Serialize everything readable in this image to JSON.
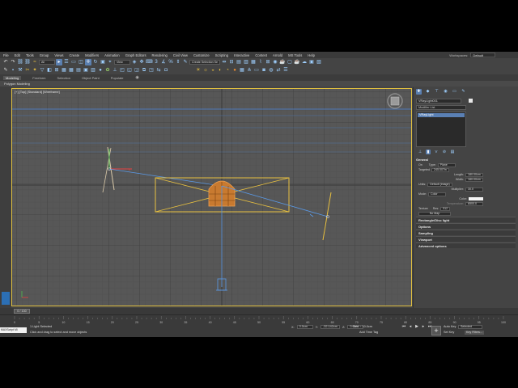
{
  "menu": [
    "File",
    "Edit",
    "Tools",
    "Group",
    "Views",
    "Create",
    "Modifiers",
    "Animation",
    "Graph Editors",
    "Rendering",
    "Civil View",
    "Customize",
    "Scripting",
    "Interactive",
    "Content",
    "Arnold",
    "MS Tools",
    "Help"
  ],
  "workspace": {
    "label": "Workspaces:",
    "value": "Default"
  },
  "toolbar": {
    "filter_dropdown": "All",
    "view_dropdown": "View",
    "selection_set": "Create Selection Se"
  },
  "ribbon": {
    "tabs": [
      "Modeling",
      "Freeform",
      "Selection",
      "Object Paint",
      "Populate"
    ],
    "active_subtitle": "Polygon Modeling"
  },
  "viewport": {
    "label": "[+] [Top] [Standard] [Wireframe]"
  },
  "command_panel": {
    "object_name": "VRayLight001",
    "modifier_list": "Modifier List",
    "stack_items": [
      "VRayLight"
    ],
    "general": {
      "header": "General",
      "on_label": "On",
      "type_label": "Type:",
      "type_value": "Plane",
      "targeted_label": "Targeted",
      "targeted_value": "245.007in",
      "length_label": "Length:",
      "length_value": "180.00cm",
      "width_label": "Width:",
      "width_value": "180.00cm",
      "units_label": "Units:",
      "units_value": "Default (image)",
      "multiplier_label": "Multiplier:",
      "multiplier_value": "30.0",
      "mode_label": "Mode:",
      "mode_value": "Color",
      "color_label": "Color:",
      "temperature_label": "Temperature:",
      "temperature_value": "6500.0",
      "texture_label": "Texture",
      "res_label": "Res:",
      "res_value": "512",
      "no_map": "No Map"
    },
    "rollouts": [
      "Rectangle/Disc light",
      "Options",
      "Sampling",
      "Viewport",
      "Advanced options"
    ]
  },
  "timeline": {
    "slider": "0 / 100",
    "ticks": [
      "0",
      "5",
      "10",
      "15",
      "20",
      "25",
      "30",
      "35",
      "40",
      "45",
      "50",
      "55",
      "60",
      "65",
      "70",
      "75",
      "80",
      "85",
      "90",
      "95",
      "100"
    ]
  },
  "status": {
    "maxscript": "MAXScript Mi",
    "line1": "1 Light Selected",
    "line2": "Click and drag to select and move objects",
    "x_label": "X:",
    "x_value": "0.0cm",
    "y_label": "Y:",
    "y_value": "-32.142cm",
    "z_label": "Z:",
    "z_value": "0.0cm",
    "grid": "Grid = 10.0cm",
    "add_time_tag": "Add Time Tag",
    "auto_key": "Auto Key",
    "set_key": "Set Key",
    "selected": "Selected",
    "key_filters": "Key Filters..."
  }
}
